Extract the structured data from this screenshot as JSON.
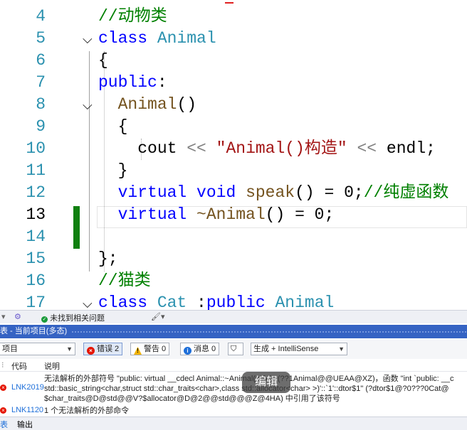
{
  "editor": {
    "line_numbers": [
      "4",
      "5",
      "6",
      "7",
      "8",
      "9",
      "10",
      "11",
      "12",
      "13",
      "14",
      "15",
      "16",
      "17"
    ],
    "lines": {
      "l4_comment": "//动物类",
      "l5_class": "class",
      "l5_name": "Animal",
      "l6": "{",
      "l7_public": "public",
      "l7_colon": ":",
      "l8_ctor": "Animal",
      "l8_parens": "()",
      "l9": "{",
      "l10_cout": "cout",
      "l10_op1": " << ",
      "l10_str": "\"Animal()构造\"",
      "l10_op2": " << ",
      "l10_endl": "endl",
      "l10_semi": ";",
      "l11": "}",
      "l12_virtual": "virtual",
      "l12_void": "void",
      "l12_speak": "speak",
      "l12_rest": "() = 0;",
      "l12_comment": "//纯虚函数",
      "l13_virtual": "virtual",
      "l13_dtor": "~Animal",
      "l13_rest": "() = 0;",
      "l15": "};",
      "l16_comment": "//猫类",
      "l17_class": "class",
      "l17_name": "Cat",
      "l17_colon": " :",
      "l17_public": "public",
      "l17_base": "Animal"
    }
  },
  "status_strip": {
    "issues": "未找到相关问题"
  },
  "error_list": {
    "title": "表 - 当前项目(多态)",
    "scope": "项目",
    "errors_btn": "错误 2",
    "warnings_btn": "警告 0",
    "messages_btn": "消息 0",
    "build_source": "生成 + IntelliSense",
    "columns": {
      "code": "代码",
      "desc": "说明"
    },
    "rows": [
      {
        "code": "LNK2019",
        "desc_lines": [
          "无法解析的外部符号 \"public: virtual __cdecl Animal::~Animal(void)\" (??1Animal@@UEAA@XZ)，函数 \"int `public: __c",
          "std::basic_string<char,struct std::char_traits<char>,class std::allocator<char> >)'::`1'::dtor$1\" (?dtor$1@?0???0Cat@",
          "$char_traits@D@std@@V?$allocator@D@2@@std@@@Z@4HA) 中引用了该符号"
        ]
      },
      {
        "code": "LNK1120",
        "desc_lines": [
          "1 个无法解析的外部命令"
        ]
      }
    ],
    "edit_overlay": "编辑"
  },
  "bottom_tabs": {
    "tab1": "表",
    "tab2": "输出"
  },
  "colors": {
    "comment": "#008000",
    "keyword": "#0000ff",
    "type": "#2b91af",
    "error": "#e51400",
    "change_bar": "#108010"
  }
}
